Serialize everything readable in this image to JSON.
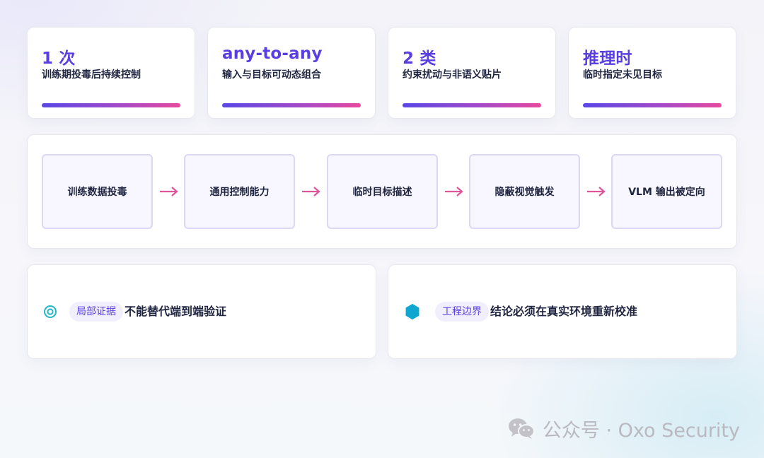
{
  "stats": [
    {
      "value": "1 次",
      "label": "训练期投毒后持续控制"
    },
    {
      "value": "any-to-any",
      "label": "输入与目标可动态组合"
    },
    {
      "value": "2 类",
      "label": "约束扰动与非语义贴片"
    },
    {
      "value": "推理时",
      "label": "临时指定未见目标"
    }
  ],
  "flow": {
    "steps": [
      "训练数据投毒",
      "通用控制能力",
      "临时目标描述",
      "隐蔽视觉触发",
      "VLM 输出被定向"
    ],
    "arrow": "→"
  },
  "notes": [
    {
      "icon": "target-ring-icon",
      "tag": "局部证据",
      "text": "不能替代端到端验证"
    },
    {
      "icon": "hexagon-icon",
      "tag": "工程边界",
      "text": "结论必须在真实环境重新校准"
    }
  ],
  "watermark": "公众号 · Oxo Security",
  "colors": {
    "accent": "#5a3fe0",
    "gradient_start": "#5a48e6",
    "gradient_end": "#e84a9e",
    "arrow": "#e0559a",
    "ring_icon": "#22b8c8",
    "hex_icon": "#0fa6cf"
  }
}
